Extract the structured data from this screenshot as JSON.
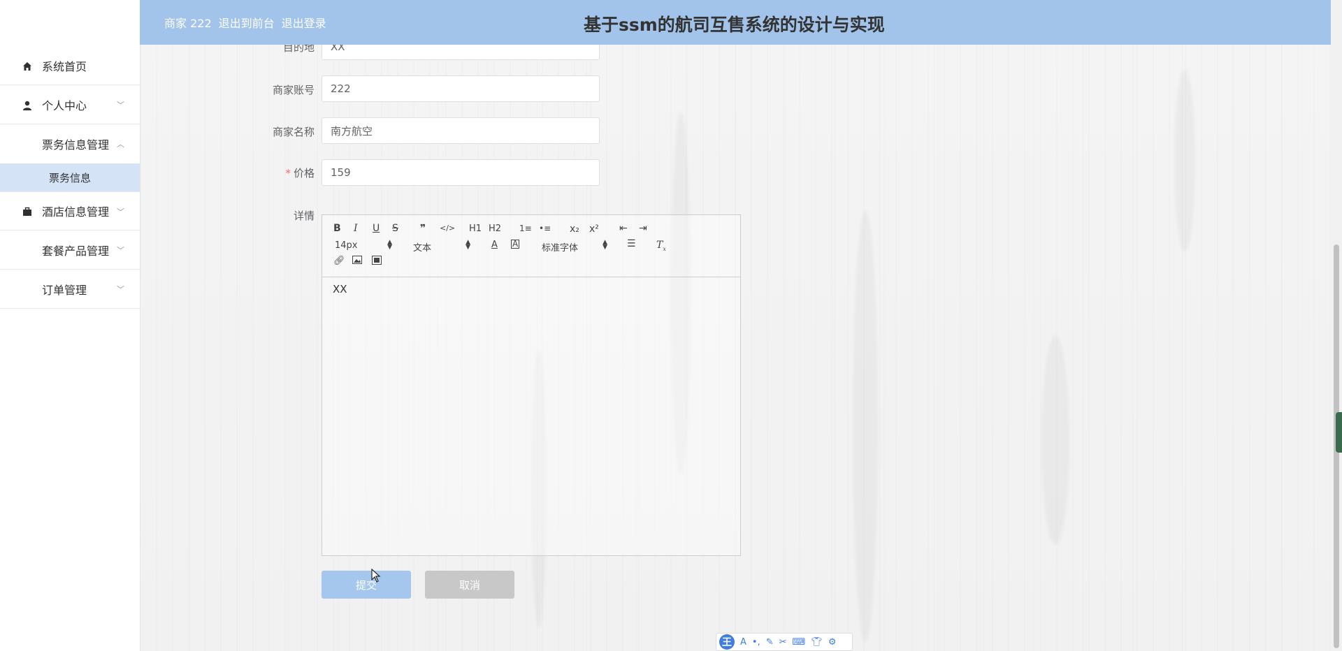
{
  "header": {
    "user_label": "商家 222",
    "to_front_label": "退出到前台",
    "logout_label": "退出登录",
    "title": "基于ssm的航司互售系统的设计与实现",
    "bg_color": "#a2c4ea"
  },
  "sidebar": {
    "items": [
      {
        "label": "系统首页",
        "icon": "home-icon"
      },
      {
        "label": "个人中心",
        "icon": "user-icon",
        "expanded": false
      },
      {
        "label": "票务信息管理",
        "icon": "grid-icon",
        "expanded": true,
        "children": [
          {
            "label": "票务信息",
            "active": true
          }
        ]
      },
      {
        "label": "酒店信息管理",
        "icon": "briefcase-icon",
        "expanded": false
      },
      {
        "label": "套餐产品管理",
        "icon": "grid-icon",
        "expanded": false
      },
      {
        "label": "订单管理",
        "icon": "grid-icon",
        "expanded": false
      }
    ],
    "active_bg": "#d4e4f6"
  },
  "form": {
    "destination": {
      "label": "目的地",
      "value": "XX"
    },
    "merchant_account": {
      "label": "商家账号",
      "value": "222"
    },
    "merchant_name": {
      "label": "商家名称",
      "value": "南方航空"
    },
    "price": {
      "label": "价格",
      "value": "159",
      "required_mark": "*"
    },
    "details": {
      "label": "详情",
      "value": "XX"
    }
  },
  "editor_toolbar": {
    "row1": [
      "B",
      "I",
      "U",
      "S",
      "❞",
      "</>",
      "H1",
      "H2",
      "1≡",
      "•≡",
      "x₂",
      "x²",
      "⇤",
      "⇥"
    ],
    "font_size": "14px",
    "text_type": "文本",
    "font_family": "标准字体"
  },
  "buttons": {
    "submit_label": "提交",
    "cancel_label": "取消",
    "submit_color": "#a5c7ee",
    "cancel_color": "#c8c8c8"
  },
  "ime": {
    "logo": "王"
  }
}
